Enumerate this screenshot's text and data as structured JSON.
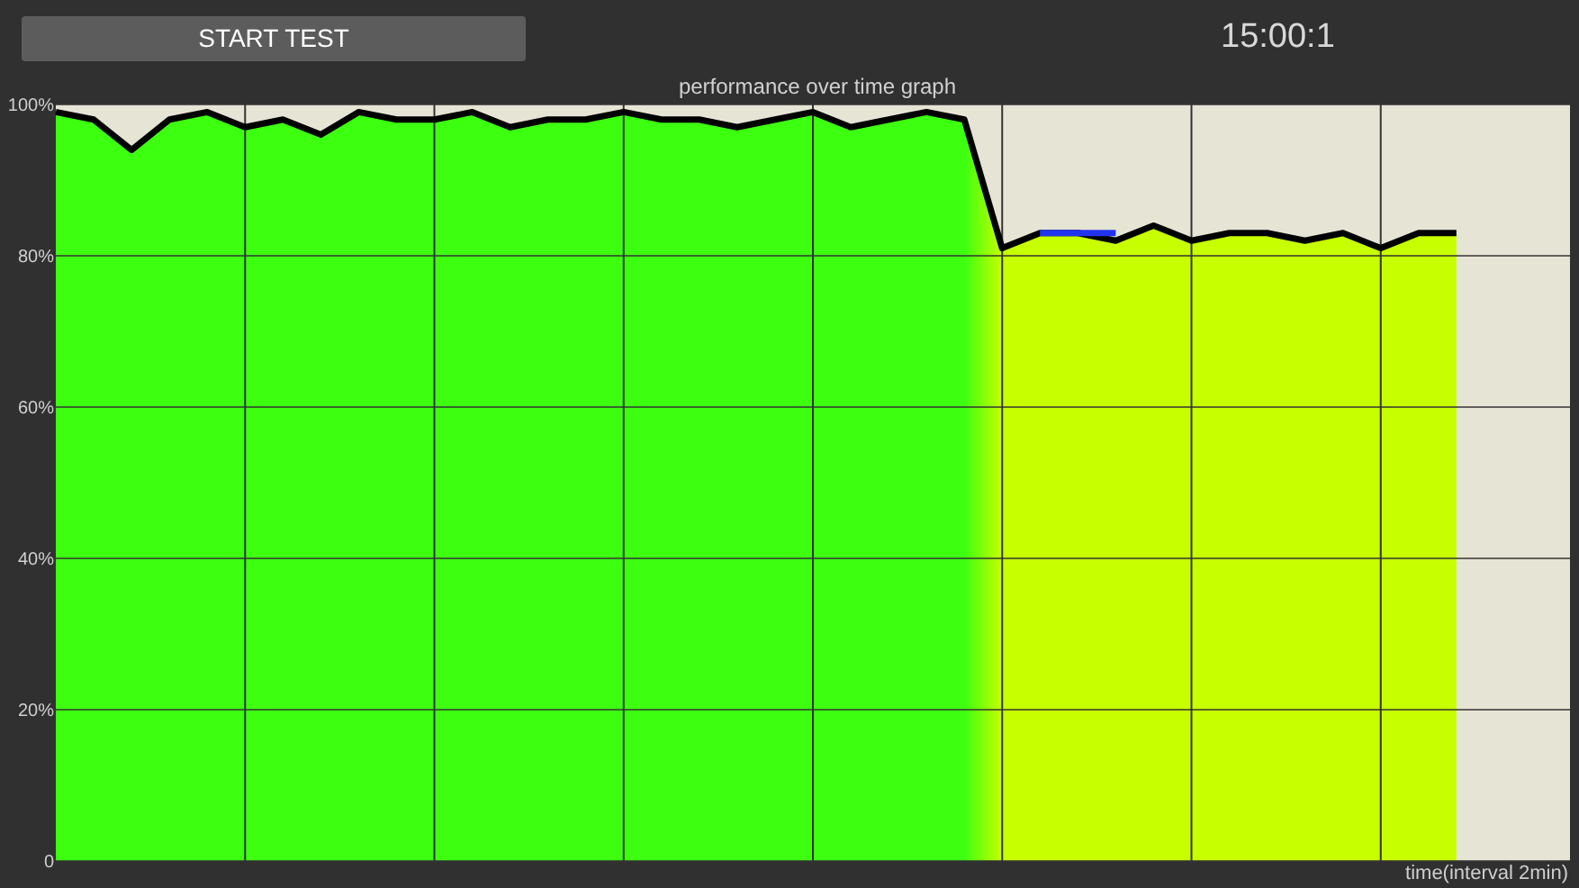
{
  "start_button": {
    "label": "START TEST"
  },
  "timer": "15:00:1",
  "chart": {
    "chart_data": {
      "type": "line",
      "title": "performance over time graph",
      "xlabel": "time(interval 2min)",
      "ylim": [
        0,
        100
      ],
      "grid": true,
      "categories": [
        null,
        null,
        null,
        null,
        null,
        null,
        null,
        null,
        null,
        null,
        null,
        null,
        null,
        null,
        null,
        null,
        null,
        null,
        null,
        null,
        null,
        null,
        null,
        null,
        null,
        null,
        null,
        null,
        null,
        null,
        null,
        null,
        null,
        null,
        null,
        null,
        null,
        null,
        null,
        null
      ],
      "yticks": [
        {
          "value": 0,
          "label": "0"
        },
        {
          "value": 20,
          "label": "20%"
        },
        {
          "value": 40,
          "label": "40%"
        },
        {
          "value": 60,
          "label": "60%"
        },
        {
          "value": 80,
          "label": "80%"
        },
        {
          "value": 100,
          "label": "100%"
        }
      ],
      "series": [
        {
          "color": "#000000",
          "values": [
            99,
            98,
            94,
            98,
            99,
            97,
            98,
            96,
            99,
            98,
            98,
            99,
            97,
            98,
            98,
            99,
            98,
            98,
            97,
            98,
            99,
            97,
            98,
            99,
            98,
            81,
            83,
            83,
            82,
            84,
            82,
            83,
            83,
            82,
            83,
            81,
            83,
            83,
            null,
            null
          ]
        },
        {
          "color": "#2233ee",
          "values": [
            null,
            null,
            null,
            null,
            null,
            null,
            null,
            null,
            null,
            null,
            null,
            null,
            null,
            null,
            null,
            null,
            null,
            null,
            null,
            null,
            null,
            null,
            null,
            null,
            null,
            null,
            83,
            83,
            83,
            null,
            null,
            null,
            null,
            null,
            null,
            null,
            null,
            null,
            null,
            null
          ]
        }
      ]
    }
  }
}
